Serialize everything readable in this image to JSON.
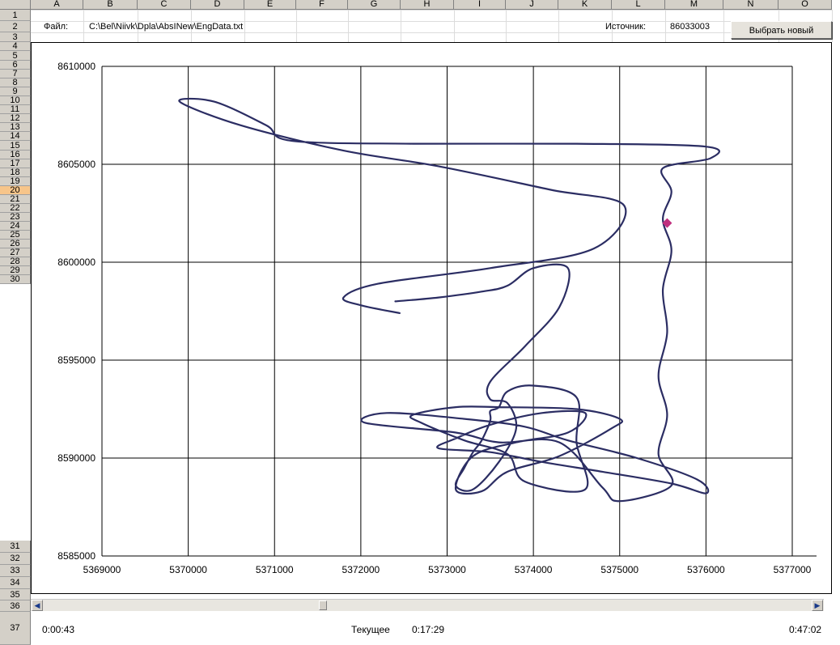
{
  "sheet": {
    "columns": [
      "A",
      "B",
      "C",
      "D",
      "E",
      "F",
      "G",
      "H",
      "I",
      "J",
      "K",
      "L",
      "M",
      "N",
      "O"
    ],
    "rows": [
      "1",
      "2",
      "3",
      "4",
      "5",
      "6",
      "7",
      "8",
      "9",
      "10",
      "11",
      "12",
      "13",
      "14",
      "15",
      "16",
      "17",
      "18",
      "19",
      "20",
      "21",
      "22",
      "23",
      "24",
      "25",
      "26",
      "27",
      "28",
      "29",
      "30",
      "31",
      "32",
      "33",
      "34",
      "35",
      "36",
      "37"
    ],
    "active_row": "20",
    "header_color": "#d4d0c8",
    "active_row_color": "#f7c58a"
  },
  "info": {
    "file_label": "Файл:",
    "file_path": "C:\\Bel\\Niivk\\Dpla\\AbsINew\\EngData.txt",
    "source_label": "Источник:",
    "source_value": "86033003",
    "select_button": "Выбрать новый"
  },
  "chart_data": {
    "type": "line",
    "line_color": "#2b2d63",
    "marker_color": "#c0307e",
    "grid": true,
    "xlim": [
      5369000,
      5377000
    ],
    "ylim": [
      8585000,
      8610000
    ],
    "x_ticks": [
      "5369000",
      "5370000",
      "5371000",
      "5372000",
      "5373000",
      "5374000",
      "5375000",
      "5376000",
      "5377000"
    ],
    "y_ticks": [
      "8610000",
      "8605000",
      "8600000",
      "8595000",
      "8590000",
      "8585000"
    ],
    "current_marker": {
      "x": 5375550,
      "y": 8602000
    },
    "track": [
      [
        5372450,
        8597400
      ],
      [
        5372000,
        8597800
      ],
      [
        5371800,
        8598200
      ],
      [
        5372200,
        8598900
      ],
      [
        5373500,
        8599700
      ],
      [
        5374700,
        8600700
      ],
      [
        5375050,
        8602900
      ],
      [
        5374200,
        8603700
      ],
      [
        5372900,
        8604900
      ],
      [
        5371800,
        8605700
      ],
      [
        5370600,
        8607000
      ],
      [
        5369900,
        8608200
      ],
      [
        5370300,
        8608200
      ],
      [
        5370900,
        8607000
      ],
      [
        5371200,
        8606200
      ],
      [
        5372600,
        8606050
      ],
      [
        5374500,
        8606050
      ],
      [
        5376000,
        8605900
      ],
      [
        5376050,
        8605300
      ],
      [
        5375500,
        8604800
      ],
      [
        5375600,
        8603600
      ],
      [
        5375500,
        8602200
      ],
      [
        5375600,
        8600600
      ],
      [
        5375500,
        8598600
      ],
      [
        5375550,
        8596400
      ],
      [
        5375450,
        8594200
      ],
      [
        5375550,
        8592200
      ],
      [
        5375450,
        8590200
      ],
      [
        5375600,
        8588600
      ],
      [
        5375000,
        8587800
      ],
      [
        5374800,
        8588500
      ],
      [
        5374300,
        8590800
      ],
      [
        5373600,
        8590800
      ],
      [
        5373100,
        8591300
      ],
      [
        5372050,
        8591800
      ],
      [
        5372300,
        8592300
      ],
      [
        5373200,
        8592000
      ],
      [
        5373900,
        8591600
      ],
      [
        5374400,
        8590900
      ],
      [
        5375200,
        8590000
      ],
      [
        5375900,
        8588900
      ],
      [
        5376000,
        8588200
      ],
      [
        5375600,
        8588700
      ],
      [
        5374800,
        8589300
      ],
      [
        5374100,
        8589800
      ],
      [
        5373500,
        8590300
      ],
      [
        5372900,
        8590500
      ],
      [
        5373100,
        8591000
      ],
      [
        5373500,
        8591700
      ],
      [
        5374100,
        8592300
      ],
      [
        5374600,
        8592300
      ],
      [
        5374400,
        8591300
      ],
      [
        5373800,
        8590800
      ],
      [
        5373300,
        8590100
      ],
      [
        5373100,
        8588400
      ],
      [
        5373400,
        8588300
      ],
      [
        5373700,
        8589300
      ],
      [
        5374300,
        8590100
      ],
      [
        5374900,
        8591500
      ],
      [
        5375000,
        8592000
      ],
      [
        5374500,
        8592500
      ],
      [
        5373600,
        8592600
      ],
      [
        5373100,
        8592600
      ],
      [
        5372600,
        8592200
      ],
      [
        5372700,
        8591800
      ],
      [
        5373200,
        8590900
      ],
      [
        5373700,
        8590200
      ],
      [
        5373900,
        8588800
      ],
      [
        5374600,
        8588400
      ],
      [
        5374500,
        8590800
      ],
      [
        5374500,
        8593100
      ],
      [
        5374000,
        8593700
      ],
      [
        5373700,
        8593400
      ],
      [
        5373600,
        8592600
      ],
      [
        5373500,
        8592400
      ],
      [
        5373500,
        8591900
      ],
      [
        5373400,
        8590900
      ],
      [
        5373300,
        8590300
      ],
      [
        5373200,
        8589500
      ],
      [
        5373100,
        8588600
      ],
      [
        5373300,
        8588400
      ],
      [
        5373600,
        8589800
      ],
      [
        5373800,
        8591500
      ],
      [
        5373700,
        8592800
      ],
      [
        5373500,
        8593000
      ],
      [
        5373500,
        8593900
      ],
      [
        5373900,
        8595700
      ],
      [
        5374300,
        8597700
      ],
      [
        5374400,
        8599700
      ],
      [
        5374000,
        8599700
      ],
      [
        5373700,
        8598800
      ],
      [
        5373400,
        8598500
      ],
      [
        5372900,
        8598200
      ],
      [
        5372400,
        8598000
      ]
    ]
  },
  "status": {
    "start_time": "0:00:43",
    "current_label": "Текущее",
    "current_time": "0:17:29",
    "end_time": "0:47:02"
  }
}
